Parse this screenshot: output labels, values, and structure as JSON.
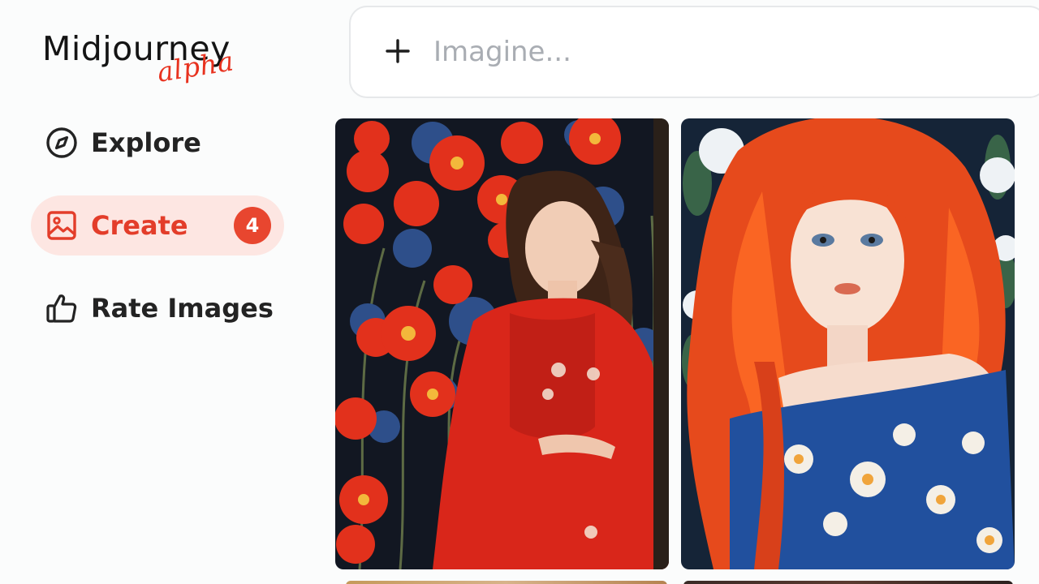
{
  "app": {
    "name": "Midjourney",
    "edition": "alpha"
  },
  "sidebar": {
    "items": [
      {
        "label": "Explore",
        "icon": "compass-icon",
        "active": false
      },
      {
        "label": "Create",
        "icon": "image-icon",
        "active": true,
        "badge": "4"
      },
      {
        "label": "Rate Images",
        "icon": "thumbs-up-icon",
        "active": false
      }
    ]
  },
  "prompt": {
    "placeholder": "Imagine...",
    "value": "",
    "add_icon": "plus-icon"
  },
  "gallery": {
    "images": [
      {
        "description_icon": "image-thumbnail",
        "palette": [
          "#e8321f",
          "#1c2a4a",
          "#f2b53a"
        ]
      },
      {
        "description_icon": "image-thumbnail",
        "palette": [
          "#ea4a1d",
          "#1f4fa0",
          "#f4e7d8"
        ]
      }
    ]
  },
  "colors": {
    "accent": "#e8462f",
    "accent_bg": "#fde6e2",
    "text": "#232323",
    "placeholder": "#a9adb3"
  }
}
